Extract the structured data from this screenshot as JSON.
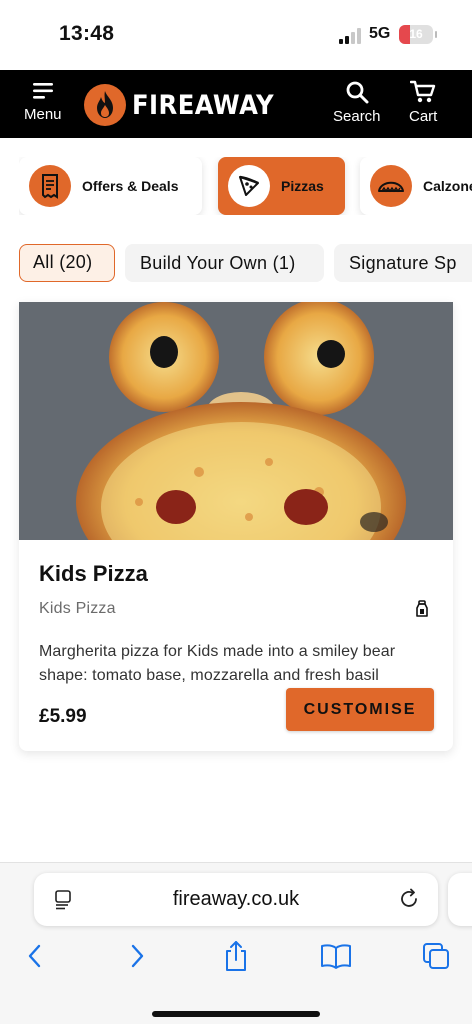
{
  "status_bar": {
    "time": "13:48",
    "network": "5G",
    "battery": "16"
  },
  "header": {
    "menu_label": "Menu",
    "brand": "FIREAWAY",
    "search_label": "Search",
    "cart_label": "Cart"
  },
  "categories": [
    {
      "label": "Offers & Deals",
      "icon": "receipt-icon",
      "selected": false
    },
    {
      "label": "Pizzas",
      "icon": "pizza-slice-icon",
      "selected": true
    },
    {
      "label": "Calzone",
      "icon": "calzone-icon",
      "selected": false
    }
  ],
  "filters": [
    {
      "label": "All (20)",
      "selected": true
    },
    {
      "label": "Build Your Own (1)",
      "selected": false
    },
    {
      "label": "Signature Sp",
      "selected": false
    }
  ],
  "product": {
    "name": "Kids Pizza",
    "subtitle": "Kids Pizza",
    "dietary_icon": "vegetarian-icon",
    "description": "Margherita pizza for Kids made into a smiley bear shape:  tomato base, mozzarella and fresh basil",
    "price": "£5.99",
    "action_label": "CUSTOMISE"
  },
  "browser": {
    "url": "fireaway.co.uk"
  },
  "colors": {
    "accent": "#e0682a",
    "header_bg": "#000000"
  }
}
